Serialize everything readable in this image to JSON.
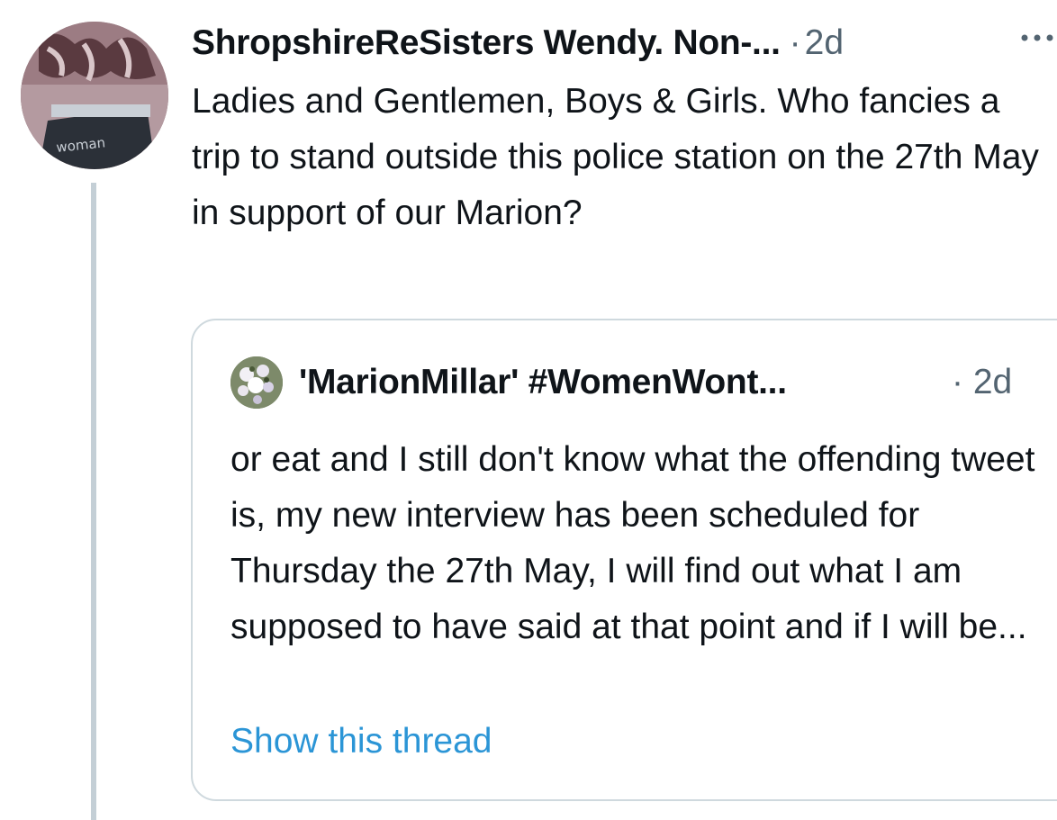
{
  "tweet": {
    "display_name": "ShropshireReSisters Wendy. Non-...",
    "separator": "·",
    "time": "2d",
    "more_icon": "more-horizontal-icon",
    "text": "Ladies and Gentlemen, Boys & Girls. Who fancies a trip to stand outside this police station on the 27th May in support of our Marion?",
    "avatar_label": "woman"
  },
  "quote": {
    "display_name": "'MarionMillar' #WomenWont...",
    "time": "· 2d",
    "text": "or eat and I still don't know what the offending tweet is, my new interview has been scheduled for Thursday the 27th May, I will find out what I am supposed to have said at that point and if I will be...",
    "link": "Show this thread"
  },
  "colors": {
    "text_primary": "#0f1419",
    "text_secondary": "#536471",
    "link": "#2b95d6",
    "border": "#cfd9de",
    "thread_line": "#c4cfd6"
  }
}
